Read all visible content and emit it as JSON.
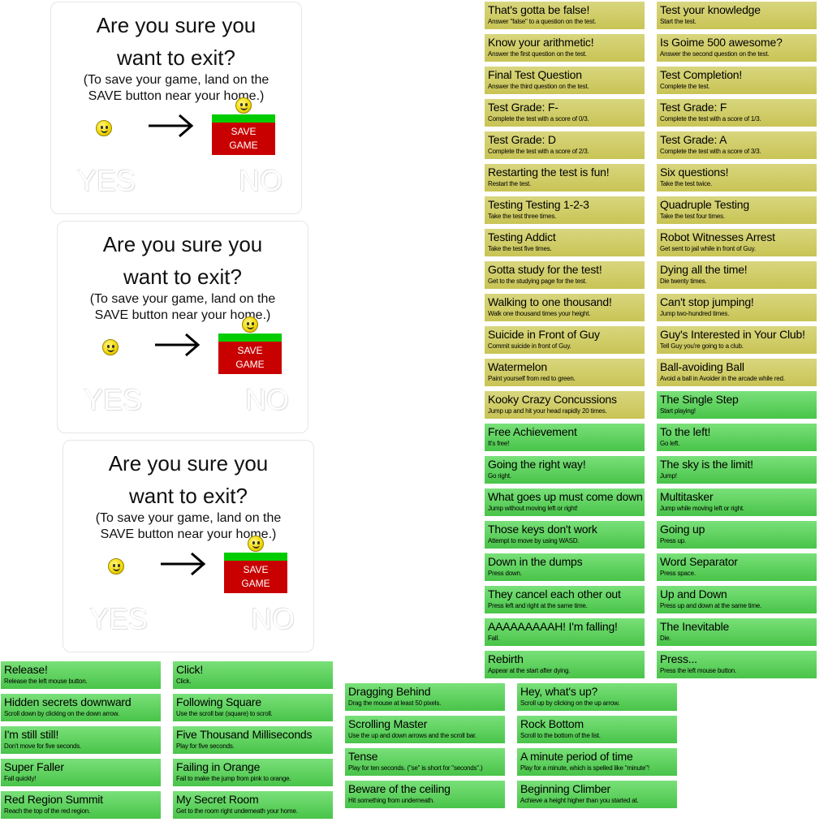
{
  "dialog": {
    "title_line1": "Are you sure you",
    "title_line2": "want to exit?",
    "sub_line1": "(To save your game, land on the",
    "sub_line2": "SAVE button near your home.)",
    "save_line1": "SAVE",
    "save_line2": "GAME",
    "yes_label": "YES",
    "no_label": "NO"
  },
  "colors": {
    "gold_badge": "#d0cd6a",
    "green_badge": "#5fd35f",
    "save_red": "#c80000",
    "save_green": "#00cc00"
  },
  "achievements": {
    "col_a": [
      {
        "title": "That's gotta be false!",
        "desc": "Answer \"false\" to a question on the test."
      },
      {
        "title": "Know your arithmetic!",
        "desc": "Answer the first question on the test."
      },
      {
        "title": "Final Test Question",
        "desc": "Answer the third question on the test."
      },
      {
        "title": "Test Grade: F-",
        "desc": "Complete the test with a score of 0/3."
      },
      {
        "title": "Test Grade: D",
        "desc": "Complete the test with a score of 2/3."
      },
      {
        "title": "Restarting the test is fun!",
        "desc": "Restart the test."
      },
      {
        "title": "Testing Testing 1-2-3",
        "desc": "Take the test three times."
      },
      {
        "title": "Testing Addict",
        "desc": "Take the test five times."
      },
      {
        "title": "Gotta study for the test!",
        "desc": "Get to the studying page for the test."
      },
      {
        "title": "Walking to one thousand!",
        "desc": "Walk one thousand times your height."
      },
      {
        "title": "Suicide in Front of Guy",
        "desc": "Commit suicide in front of Guy."
      },
      {
        "title": "Watermelon",
        "desc": "Paint yourself from red to green."
      },
      {
        "title": "Kooky Crazy Concussions",
        "desc": "Jump up and hit your head rapidly 20 times."
      },
      {
        "title": "Free Achievement",
        "desc": "It's free!"
      },
      {
        "title": "Going the right way!",
        "desc": "Go right."
      },
      {
        "title": "What goes up must come down",
        "desc": "Jump without moving left or right!"
      },
      {
        "title": "Those keys don't work",
        "desc": "Attempt to move by using WASD."
      },
      {
        "title": "Down in the dumps",
        "desc": "Press down."
      },
      {
        "title": "They cancel each other out",
        "desc": "Press left and right at the same time."
      },
      {
        "title": "AAAAAAAAAH! I'm falling!",
        "desc": "Fall."
      },
      {
        "title": "Rebirth",
        "desc": "Appear at the start after dying."
      }
    ],
    "col_b": [
      {
        "title": "Test your knowledge",
        "desc": "Start the test."
      },
      {
        "title": "Is Goime 500 awesome?",
        "desc": "Answer the second question on the test."
      },
      {
        "title": "Test Completion!",
        "desc": "Complete the test."
      },
      {
        "title": "Test Grade: F",
        "desc": "Complete the test with a score of 1/3."
      },
      {
        "title": "Test Grade: A",
        "desc": "Complete the test with a score of 3/3."
      },
      {
        "title": "Six questions!",
        "desc": "Take the test twice."
      },
      {
        "title": "Quadruple Testing",
        "desc": "Take the test four times."
      },
      {
        "title": "Robot Witnesses Arrest",
        "desc": "Get sent to jail while in front of Guy."
      },
      {
        "title": "Dying all the time!",
        "desc": "Die twenty times."
      },
      {
        "title": "Can't stop jumping!",
        "desc": "Jump two-hundred times."
      },
      {
        "title": "Guy's Interested in Your Club!",
        "desc": "Tell Guy you're going to a club."
      },
      {
        "title": "Ball-avoiding Ball",
        "desc": "Avoid a ball in Avoider in the arcade while red."
      },
      {
        "title": "The Single Step",
        "desc": "Start playing!"
      },
      {
        "title": "To the left!",
        "desc": "Go left."
      },
      {
        "title": "The sky is the limit!",
        "desc": "Jump!"
      },
      {
        "title": "Multitasker",
        "desc": "Jump while moving left or right."
      },
      {
        "title": "Going up",
        "desc": "Press up."
      },
      {
        "title": "Word Separator",
        "desc": "Press space."
      },
      {
        "title": "Up and Down",
        "desc": "Press up and down at the same time."
      },
      {
        "title": "The Inevitable",
        "desc": "Die."
      },
      {
        "title": "Press...",
        "desc": "Press the left mouse button."
      }
    ],
    "col_c": [
      {
        "title": "Release!",
        "desc": "Release the left mouse button."
      },
      {
        "title": "Hidden secrets downward",
        "desc": "Scroll down by clicking on the down arrow."
      },
      {
        "title": "I'm still still!",
        "desc": "Don't move for five seconds."
      },
      {
        "title": "Super Faller",
        "desc": "Fall quickly!"
      },
      {
        "title": "Red Region Summit",
        "desc": "Reach the top of the red region."
      }
    ],
    "col_d": [
      {
        "title": "Click!",
        "desc": "Click."
      },
      {
        "title": "Following Square",
        "desc": "Use the scroll bar (square) to scroll."
      },
      {
        "title": "Five Thousand Milliseconds",
        "desc": "Play for five seconds."
      },
      {
        "title": "Failing in Orange",
        "desc": "Fail to make the jump from pink to orange."
      },
      {
        "title": "My Secret Room",
        "desc": "Get to the room right underneath your home."
      }
    ],
    "col_e": [
      {
        "title": "Dragging Behind",
        "desc": "Drag the mouse at least 50 pixels."
      },
      {
        "title": "Scrolling Master",
        "desc": "Use the up and down arrows and the scroll bar."
      },
      {
        "title": "Tense",
        "desc": "Play for ten seconds. (\"se\" is short for \"seconds\".)"
      },
      {
        "title": "Beware of the ceiling",
        "desc": "Hit something from underneath."
      }
    ],
    "col_f": [
      {
        "title": "Hey, what's up?",
        "desc": "Scroll up by clicking on the up arrow."
      },
      {
        "title": "Rock Bottom",
        "desc": "Scroll to the bottom of the list."
      },
      {
        "title": "A minute period of time",
        "desc": "Play for a minute, which is spelled like \"minute\"!"
      },
      {
        "title": "Beginning Climber",
        "desc": "Achieve a height higher than you started at."
      }
    ]
  }
}
